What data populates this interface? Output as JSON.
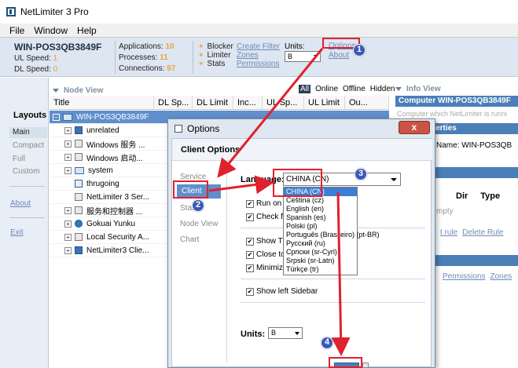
{
  "window": {
    "title": "NetLimiter 3 Pro"
  },
  "menu": [
    "File",
    "Window",
    "Help"
  ],
  "header": {
    "hostname": "WIN-POS3QB3849F",
    "ul_label": "UL Speed:",
    "ul_value": "1",
    "dl_label": "DL Speed:",
    "dl_value": "0",
    "applications_label": "Applications:",
    "applications_value": "10",
    "processes_label": "Processes:",
    "processes_value": "11",
    "connections_label": "Connections:",
    "connections_value": "97",
    "modules": [
      "Blocker",
      "Limiter",
      "Stats"
    ],
    "links": [
      "Create Filter",
      "Zones",
      "Permissions"
    ],
    "units_label": "Units:",
    "units_value": "B",
    "options_link": "Options",
    "about_link": "About"
  },
  "layouts": {
    "heading": "Layouts",
    "items": [
      "Main",
      "Compact",
      "Full",
      "Custom"
    ],
    "about": "About",
    "exit": "Exit"
  },
  "nodeview": {
    "heading": "Node View",
    "filters": [
      "All",
      "Online",
      "Offline",
      "Hidden"
    ],
    "columns": [
      "Title",
      "DL Sp...",
      "DL Limit",
      "Inc...",
      "UL Sp...",
      "UL Limit",
      "Ou..."
    ],
    "rows": [
      {
        "label": "WIN-POS3QB3849F",
        "expander": "−",
        "icon": "computer-icon"
      },
      {
        "label": "unrelated",
        "expander": "+",
        "icon": "filter-icon"
      },
      {
        "label": "Windows 服务 ...",
        "expander": "+",
        "icon": "app-icon"
      },
      {
        "label": "Windows 启动...",
        "expander": "+",
        "icon": "app-icon"
      },
      {
        "label": "system",
        "expander": "+",
        "icon": "folder-icon"
      },
      {
        "label": "thrugoing",
        "expander": "",
        "icon": "node-icon"
      },
      {
        "label": "NetLimiter 3 Ser...",
        "expander": "",
        "icon": "app-icon"
      },
      {
        "label": "服务和控制器 ...",
        "expander": "+",
        "icon": "app-icon"
      },
      {
        "label": "Gokuai Yunku",
        "expander": "+",
        "icon": "globe-icon"
      },
      {
        "label": "Local Security A...",
        "expander": "+",
        "icon": "app-icon"
      },
      {
        "label": "NetLimiter3 Clie...",
        "expander": "+",
        "icon": "netlimiter-icon"
      }
    ]
  },
  "infoview": {
    "heading": "Info View",
    "computer_title": "Computer WIN-POS3QB3849F",
    "description": "Computer which NetLimiter is runni",
    "properties_title": "perties",
    "name_line": "Name: WIN-POS3QB",
    "col_dir": "Dir",
    "col_type": "Type",
    "empty": "mpty",
    "links": [
      "t rule",
      "Delete Rule"
    ],
    "links2": [
      "Permissions",
      "Zones"
    ]
  },
  "dialog": {
    "title": "Options",
    "close": "x",
    "section": "Client Options",
    "nav": [
      "Service",
      "Client",
      "Stats",
      "Node View",
      "Chart"
    ],
    "language_label": "Language:",
    "language_value": "CHINA (CN)",
    "language_options": [
      "CHINA (CN)",
      "Čeština (cz)",
      "English (en)",
      "Spanish (es)",
      "Polski (pl)",
      "Português (Brasileiro) (pt-BR)",
      "Русский (ru)",
      "Српски (sr-Cyrl)",
      "Srpski (sr-Latn)",
      "Türkçe (tr)"
    ],
    "checkboxes": [
      "Run on S",
      "Check fo",
      "Show Tra",
      "Close to",
      "Minimize",
      "Show left Sidebar"
    ],
    "units_label": "Units:",
    "units_value": "B"
  },
  "annotations": [
    "1",
    "2",
    "3",
    "4"
  ],
  "colors": {
    "annotation_red": "#e0212e",
    "badge_blue": "#3a58b8",
    "selection_blue": "#5f8fcc",
    "accent_orange": "#e9a441"
  }
}
